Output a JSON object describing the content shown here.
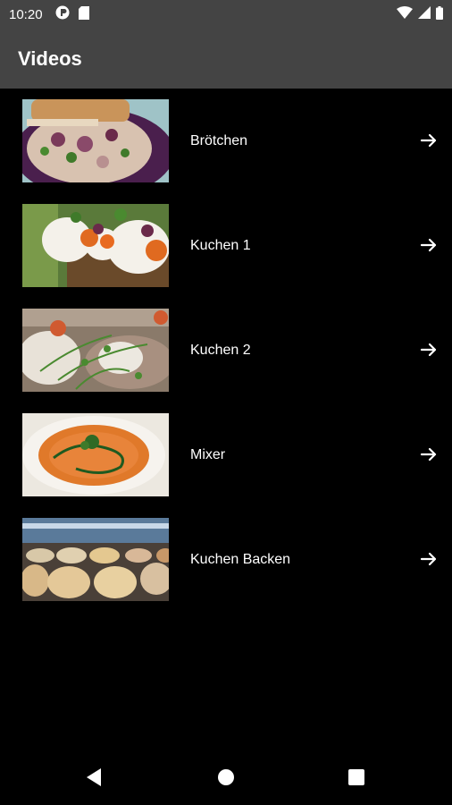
{
  "status_bar": {
    "time": "10:20",
    "left_icons": [
      "app-notification-icon",
      "sd-card-icon"
    ],
    "right_icons": [
      "wifi-icon",
      "signal-icon",
      "battery-icon"
    ]
  },
  "app_bar": {
    "title": "Videos"
  },
  "videos": [
    {
      "label": "Brötchen",
      "thumbnail": "toast-with-herbs-thumbnail",
      "action_icon": "arrow-right-icon"
    },
    {
      "label": "Kuchen 1",
      "thumbnail": "eggs-with-sprouts-thumbnail",
      "action_icon": "arrow-right-icon"
    },
    {
      "label": "Kuchen 2",
      "thumbnail": "roll-with-cress-thumbnail",
      "action_icon": "arrow-right-icon"
    },
    {
      "label": "Mixer",
      "thumbnail": "orange-soup-thumbnail",
      "action_icon": "arrow-right-icon"
    },
    {
      "label": "Kuchen Backen",
      "thumbnail": "pastry-display-thumbnail",
      "action_icon": "arrow-right-icon"
    }
  ],
  "nav_bar": {
    "buttons": [
      "back-icon",
      "home-icon",
      "recents-icon"
    ]
  },
  "colors": {
    "app_bar": "#444444",
    "background": "#000000",
    "text": "#ffffff"
  }
}
